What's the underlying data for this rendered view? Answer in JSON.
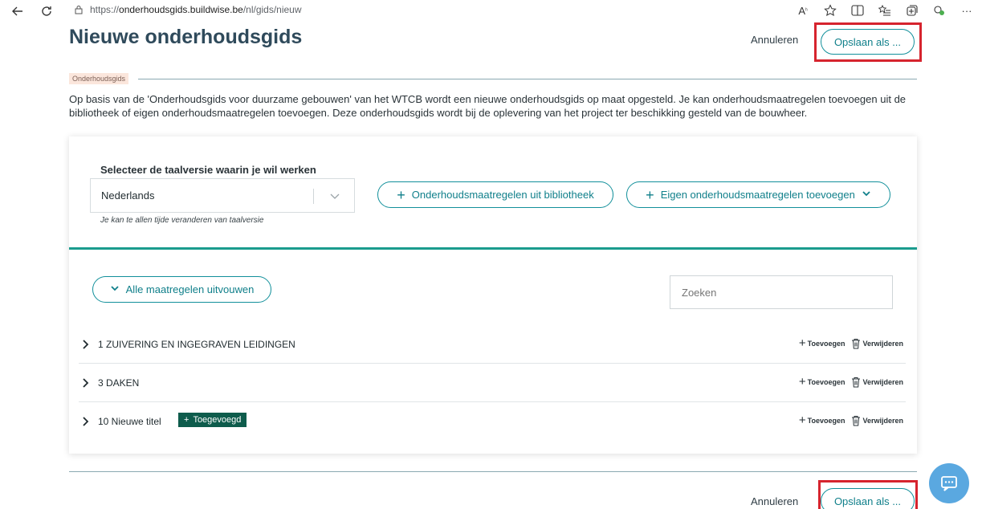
{
  "browser": {
    "url_prefix": "https://",
    "url_host": "onderhoudsgids.buildwise.be",
    "url_path": "/nl/gids/nieuw",
    "icons": [
      "back-icon",
      "refresh-icon",
      "lock-icon",
      "read-aloud-icon",
      "favorite-icon",
      "split-screen-icon",
      "favorites-list-icon",
      "collections-icon",
      "extension-icon",
      "more-icon"
    ]
  },
  "header": {
    "title": "Nieuwe onderhoudsgids",
    "cancel_label": "Annuleren",
    "save_label": "Opslaan als ..."
  },
  "section": {
    "tag": "Onderhoudsgids",
    "intro": "Op basis van de 'Onderhoudsgids voor duurzame gebouwen' van het WTCB wordt een nieuwe onderhoudsgids op maat opgesteld. Je kan onderhoudsmaatregelen toevoegen uit de bibliotheek of eigen onderhoudsmaatregelen toevoegen. Deze onderhoudsgids wordt bij de oplevering van het project ter beschikking gesteld van de bouwheer."
  },
  "language": {
    "label": "Selecteer de taalversie waarin je wil werken",
    "value": "Nederlands",
    "hint": "Je kan te allen tijde veranderen van taalversie"
  },
  "actions": {
    "library_label": "Onderhoudsmaatregelen uit bibliotheek",
    "own_label": "Eigen onderhoudsmaatregelen toevoegen",
    "expand_label": "Alle maatregelen uitvouwen",
    "search_placeholder": "Zoeken"
  },
  "rows": [
    {
      "title": "1 ZUIVERING EN INGEGRAVEN LEIDINGEN",
      "add_label": "Toevoegen",
      "delete_label": "Verwijderen"
    },
    {
      "title": "3 DAKEN",
      "add_label": "Toevoegen",
      "delete_label": "Verwijderen"
    },
    {
      "title": "10 Nieuwe titel",
      "badge": "Toegevoegd",
      "add_label": "Toevoegen",
      "delete_label": "Verwijderen"
    }
  ],
  "footer": {
    "cancel_label": "Annuleren",
    "save_label": "Opslaan als ..."
  },
  "colors": {
    "accent": "#12909b",
    "title": "#2f4a5b",
    "highlight": "#d6242e",
    "badge": "#0e5c4c",
    "divider": "#1a9c8e",
    "chat": "#5aa8e0"
  }
}
